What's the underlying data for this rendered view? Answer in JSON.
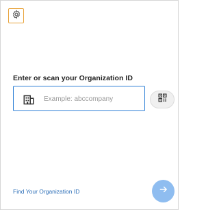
{
  "settings": {
    "icon": "gear-icon",
    "accent": "#e8a33a"
  },
  "login": {
    "prompt": "Enter or scan your Organization ID",
    "input_placeholder": "Example: abccompany",
    "input_value": "",
    "input_icon": "building-icon",
    "input_border_color": "#2d7fd6",
    "scan_icon": "qr-code-icon"
  },
  "footer": {
    "find_link": "Find Your Organization ID",
    "next_icon": "arrow-right-icon",
    "next_color": "#8fbdf0"
  }
}
